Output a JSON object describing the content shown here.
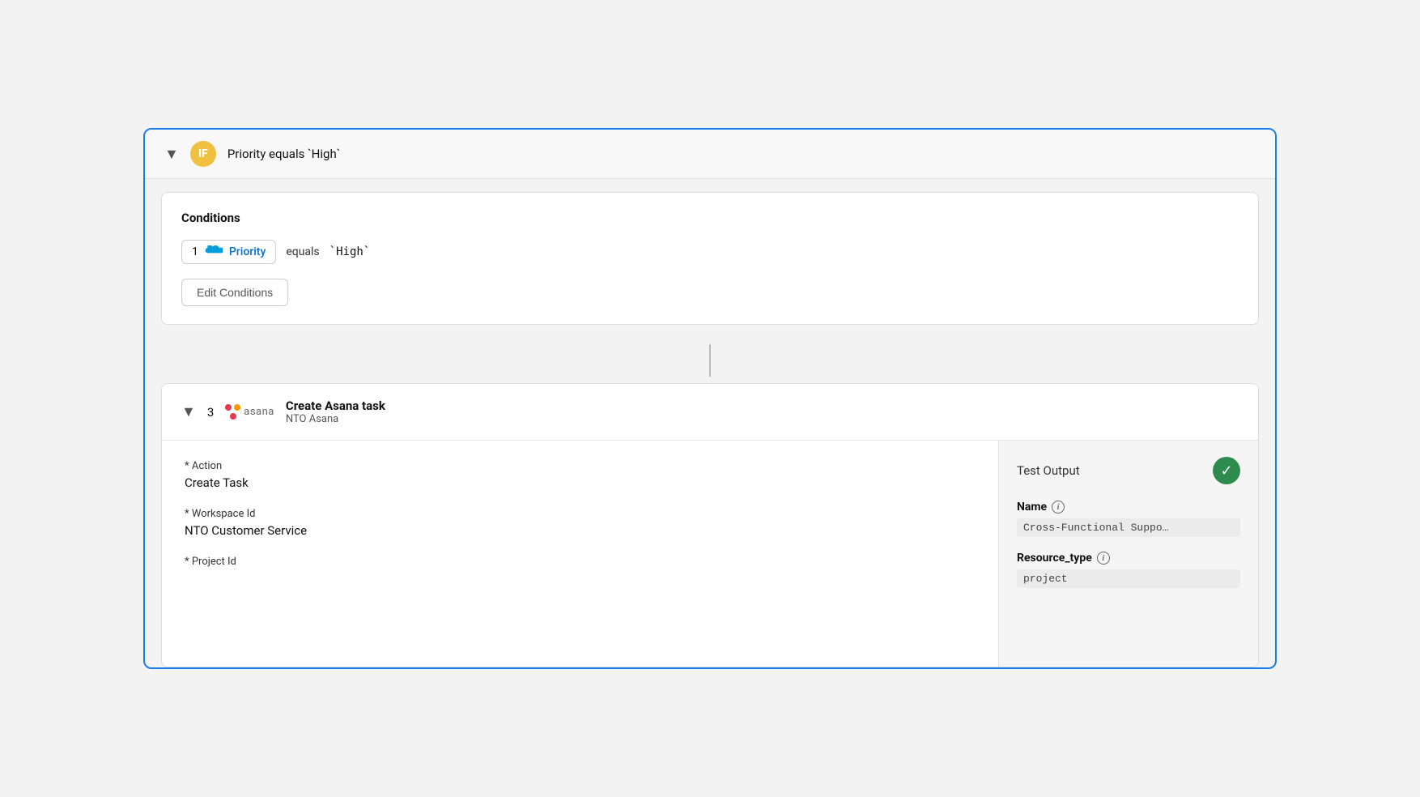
{
  "if_header": {
    "chevron": "▼",
    "badge": "IF",
    "title": "Priority equals `High`"
  },
  "conditions": {
    "section_title": "Conditions",
    "condition_number": "1",
    "condition_field": "Priority",
    "condition_operator": "equals",
    "condition_value": "`High`",
    "edit_button_label": "Edit Conditions"
  },
  "asana_step": {
    "chevron": "▼",
    "step_number": "3",
    "logo_text": "asana",
    "task_title": "Create Asana task",
    "subtitle": "NTO Asana"
  },
  "form": {
    "action_label": "Action",
    "action_value": "Create Task",
    "workspace_label": "Workspace Id",
    "workspace_value": "NTO Customer Service",
    "project_label": "Project Id"
  },
  "test_output": {
    "label": "Test Output",
    "name_label": "Name",
    "name_info": "i",
    "name_value": "Cross-Functional Suppo…",
    "resource_type_label": "Resource_type",
    "resource_type_info": "i",
    "resource_type_value": "project"
  }
}
